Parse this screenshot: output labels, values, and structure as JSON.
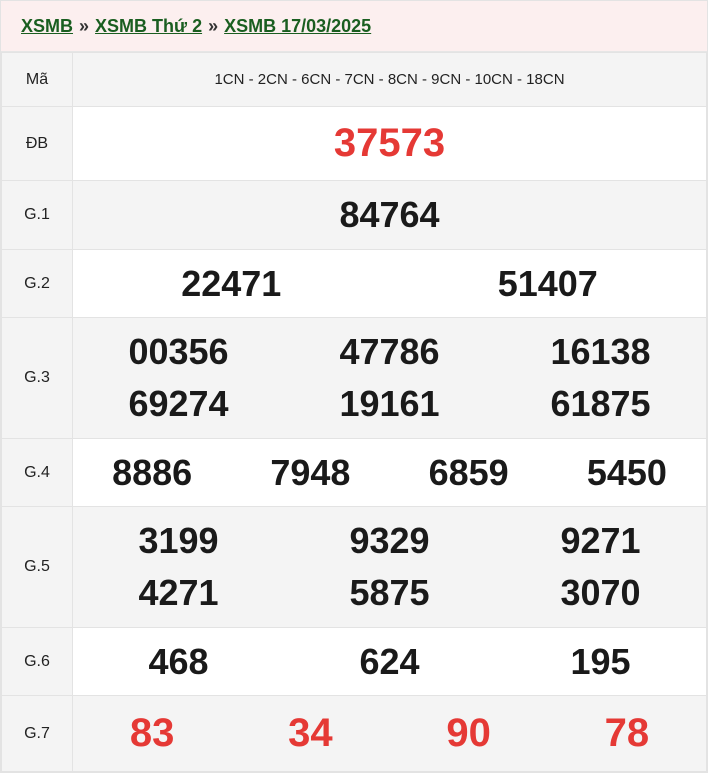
{
  "breadcrumb": {
    "items": [
      "XSMB",
      "XSMB Thứ 2",
      "XSMB 17/03/2025"
    ],
    "separator": "»"
  },
  "table": {
    "ma": {
      "label": "Mã",
      "value": "1CN - 2CN - 6CN - 7CN - 8CN - 9CN - 10CN - 18CN"
    },
    "db": {
      "label": "ĐB",
      "values": [
        "37573"
      ]
    },
    "g1": {
      "label": "G.1",
      "values": [
        "84764"
      ]
    },
    "g2": {
      "label": "G.2",
      "values": [
        "22471",
        "51407"
      ]
    },
    "g3": {
      "label": "G.3",
      "values": [
        "00356",
        "47786",
        "16138",
        "69274",
        "19161",
        "61875"
      ]
    },
    "g4": {
      "label": "G.4",
      "values": [
        "8886",
        "7948",
        "6859",
        "5450"
      ]
    },
    "g5": {
      "label": "G.5",
      "values": [
        "3199",
        "9329",
        "9271",
        "4271",
        "5875",
        "3070"
      ]
    },
    "g6": {
      "label": "G.6",
      "values": [
        "468",
        "624",
        "195"
      ]
    },
    "g7": {
      "label": "G.7",
      "values": [
        "83",
        "34",
        "90",
        "78"
      ]
    }
  },
  "colors": {
    "accent_red": "#e53935",
    "link_green": "#1a5e20",
    "header_bg": "#fcefef"
  }
}
